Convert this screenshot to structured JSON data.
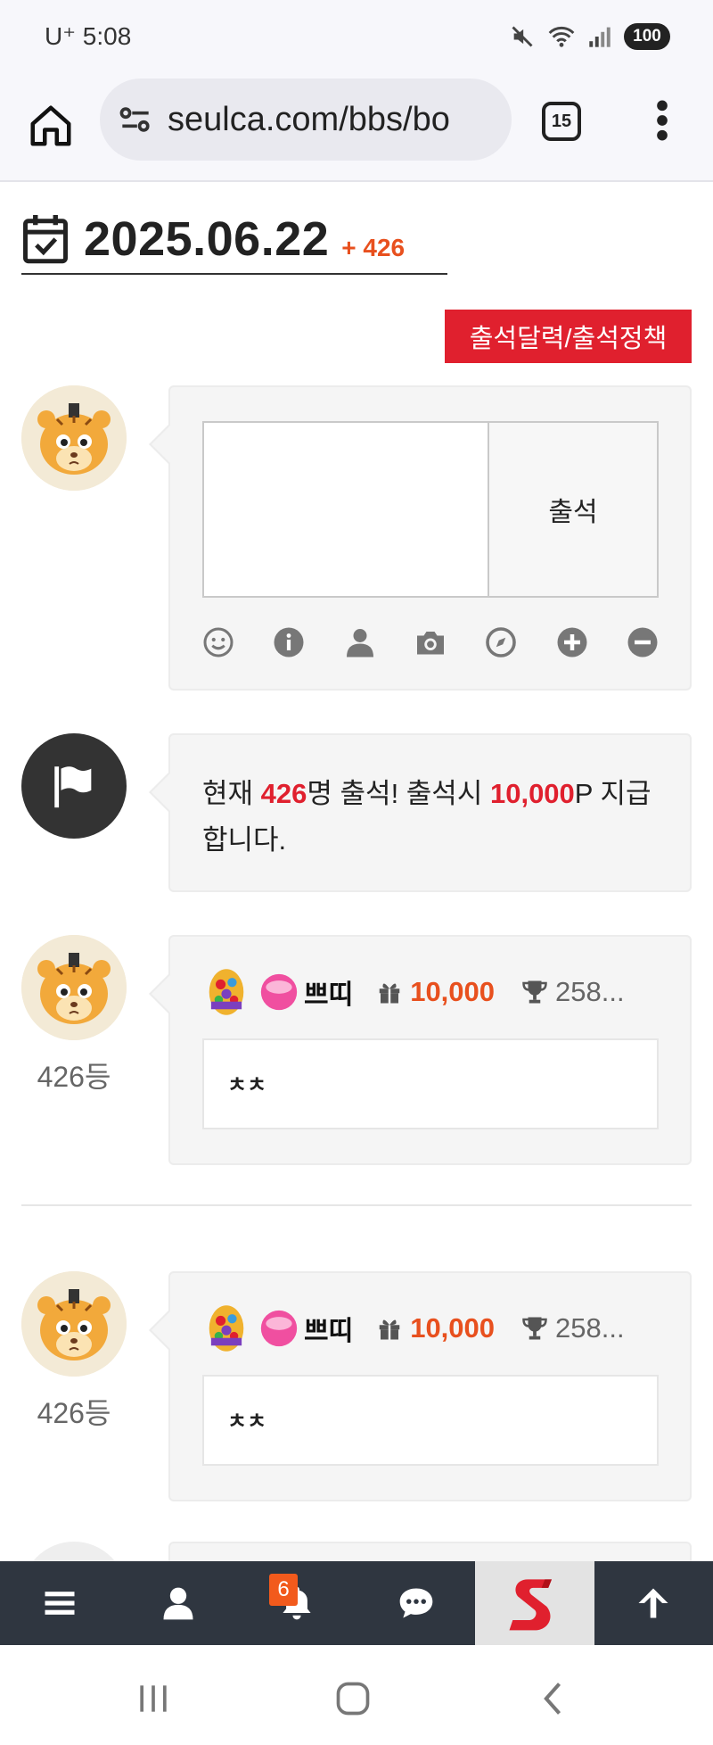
{
  "status_bar": {
    "carrier_time": "U⁺ 5:08",
    "battery": "100"
  },
  "browser": {
    "url": "seulca.com/bbs/bo",
    "tab_count": "15"
  },
  "header": {
    "date": "2025.06.22",
    "count": "+ 426",
    "policy_button": "출석달력/출석정책"
  },
  "compose": {
    "submit_label": "출석",
    "textarea_value": "",
    "tools": [
      "smile-icon",
      "info-icon",
      "user-icon",
      "camera-icon",
      "compass-icon",
      "plus-circle-icon",
      "minus-circle-icon"
    ]
  },
  "notice": {
    "prefix": "현재 ",
    "count": "426",
    "middle": "명 출석! 출석시 ",
    "points": "10,000",
    "suffix": "P 지급합니다."
  },
  "entries": [
    {
      "rank": "426등",
      "nickname": "쁘띠",
      "points": "10,000",
      "trophy": "258...",
      "message": "ㅊㅊ"
    },
    {
      "rank": "426등",
      "nickname": "쁘띠",
      "points": "10,000",
      "trophy": "258...",
      "message": "ㅊㅊ"
    }
  ],
  "bottom_nav": {
    "notification_count": "6",
    "items": [
      "menu-icon",
      "user-icon",
      "bell-icon",
      "chat-icon",
      "site-logo",
      "arrow-up-icon"
    ]
  },
  "colors": {
    "accent_red": "#e0202e",
    "accent_orange": "#e8501e",
    "nav_bg": "#2f3640"
  }
}
